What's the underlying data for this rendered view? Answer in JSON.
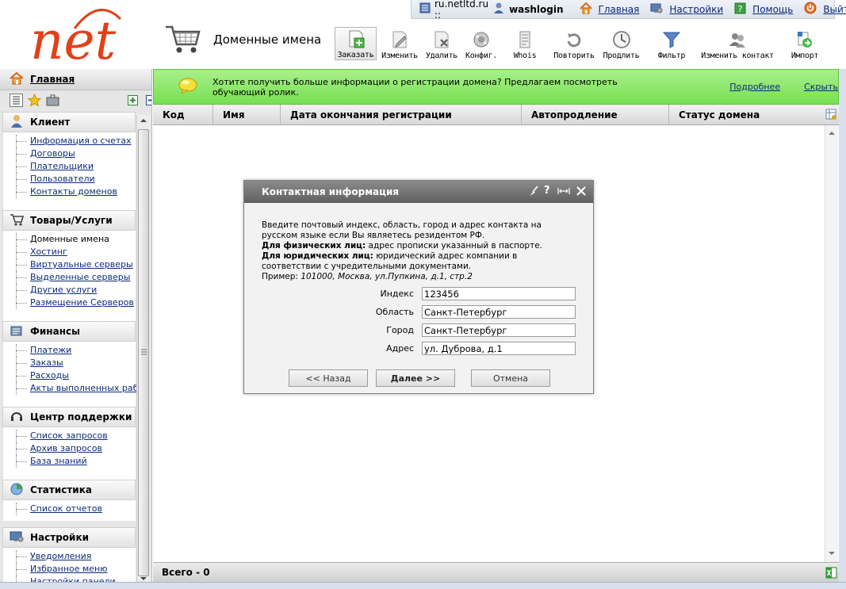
{
  "topbar": {
    "host": "ru.netltd.ru ::",
    "user": "washlogin",
    "links": [
      {
        "label": "Главная",
        "icon": "home-icon"
      },
      {
        "label": "Настройки",
        "icon": "settings-icon"
      },
      {
        "label": "Помощь",
        "icon": "help-icon"
      },
      {
        "label": "Выйти",
        "icon": "power-icon"
      }
    ]
  },
  "logo": {
    "text": "net"
  },
  "page_title": "Доменные имена",
  "toolbar": [
    {
      "label": "Заказать",
      "icon": "add-doc-icon",
      "active": true
    },
    {
      "label": "Изменить",
      "icon": "edit-doc-icon"
    },
    {
      "label": "Удалить",
      "icon": "delete-doc-icon"
    },
    {
      "label": "Конфиг.",
      "icon": "config-icon"
    },
    {
      "label": "Whois",
      "icon": "whois-icon"
    },
    {
      "label": "Повторить",
      "icon": "repeat-icon"
    },
    {
      "label": "Продлить",
      "icon": "clock-icon"
    },
    {
      "label": "Фильтр",
      "icon": "filter-icon"
    },
    {
      "label": "Изменить контакт",
      "icon": "contacts-icon"
    },
    {
      "label": "Импорт",
      "icon": "import-icon"
    }
  ],
  "sidebar": {
    "home_label": "Главная",
    "sections": [
      {
        "title": "Клиент",
        "icon": "client-icon",
        "items": [
          "Информация о счетах",
          "Договоры",
          "Плательщики",
          "Пользователи",
          "Контакты доменов"
        ]
      },
      {
        "title": "Товары/Услуги",
        "icon": "cart-icon",
        "items": [
          "Доменные имена",
          "Хостинг",
          "Виртуальные серверы",
          "Выделенные серверы",
          "Другие услуги",
          "Размещение Серверов"
        ]
      },
      {
        "title": "Финансы",
        "icon": "finance-icon",
        "items": [
          "Платежи",
          "Заказы",
          "Расходы",
          "Акты выполненных работ"
        ]
      },
      {
        "title": "Центр поддержки",
        "icon": "headset-icon",
        "items": [
          "Список запросов",
          "Архив запросов",
          "База знаний"
        ]
      },
      {
        "title": "Статистика",
        "icon": "stats-icon",
        "items": [
          "Список отчетов"
        ]
      },
      {
        "title": "Настройки",
        "icon": "settings-panel-icon",
        "items": [
          "Уведомления",
          "Избранное меню",
          "Настройки панели"
        ]
      }
    ]
  },
  "banner": {
    "text": "Хотите получить больше информации о регистрации домена? Предлагаем посмотреть обучающий ролик.",
    "more": "Подробнее",
    "hide": "Скрыть"
  },
  "table": {
    "columns": [
      "Код",
      "Имя",
      "Дата окончания регистрации",
      "Автопродление",
      "Статус домена"
    ],
    "total": "Всего - 0"
  },
  "dialog": {
    "title": "Контактная информация",
    "intro": "Введите почтовый индекс, область, город и адрес контакта на русском языке если Вы являетесь резидентом РФ.",
    "phys_label": "Для физических лиц:",
    "phys_text": " адрес прописки указанный в паспорте.",
    "jur_label": "Для юридических лиц:",
    "jur_text": " юридический адрес компании в соответствии с учредительными документами.",
    "example_label": "Пример: ",
    "example_text": "101000, Москва, ул.Пупкина, д.1, стр.2",
    "fields": [
      {
        "label": "Индекс",
        "value": "123456"
      },
      {
        "label": "Область",
        "value": "Санкт-Петербург"
      },
      {
        "label": "Город",
        "value": "Санкт-Петербург"
      },
      {
        "label": "Адрес",
        "value": "ул. Дуброва, д.1"
      }
    ],
    "back": "<< Назад",
    "next": "Далее >>",
    "cancel": "Отмена"
  }
}
